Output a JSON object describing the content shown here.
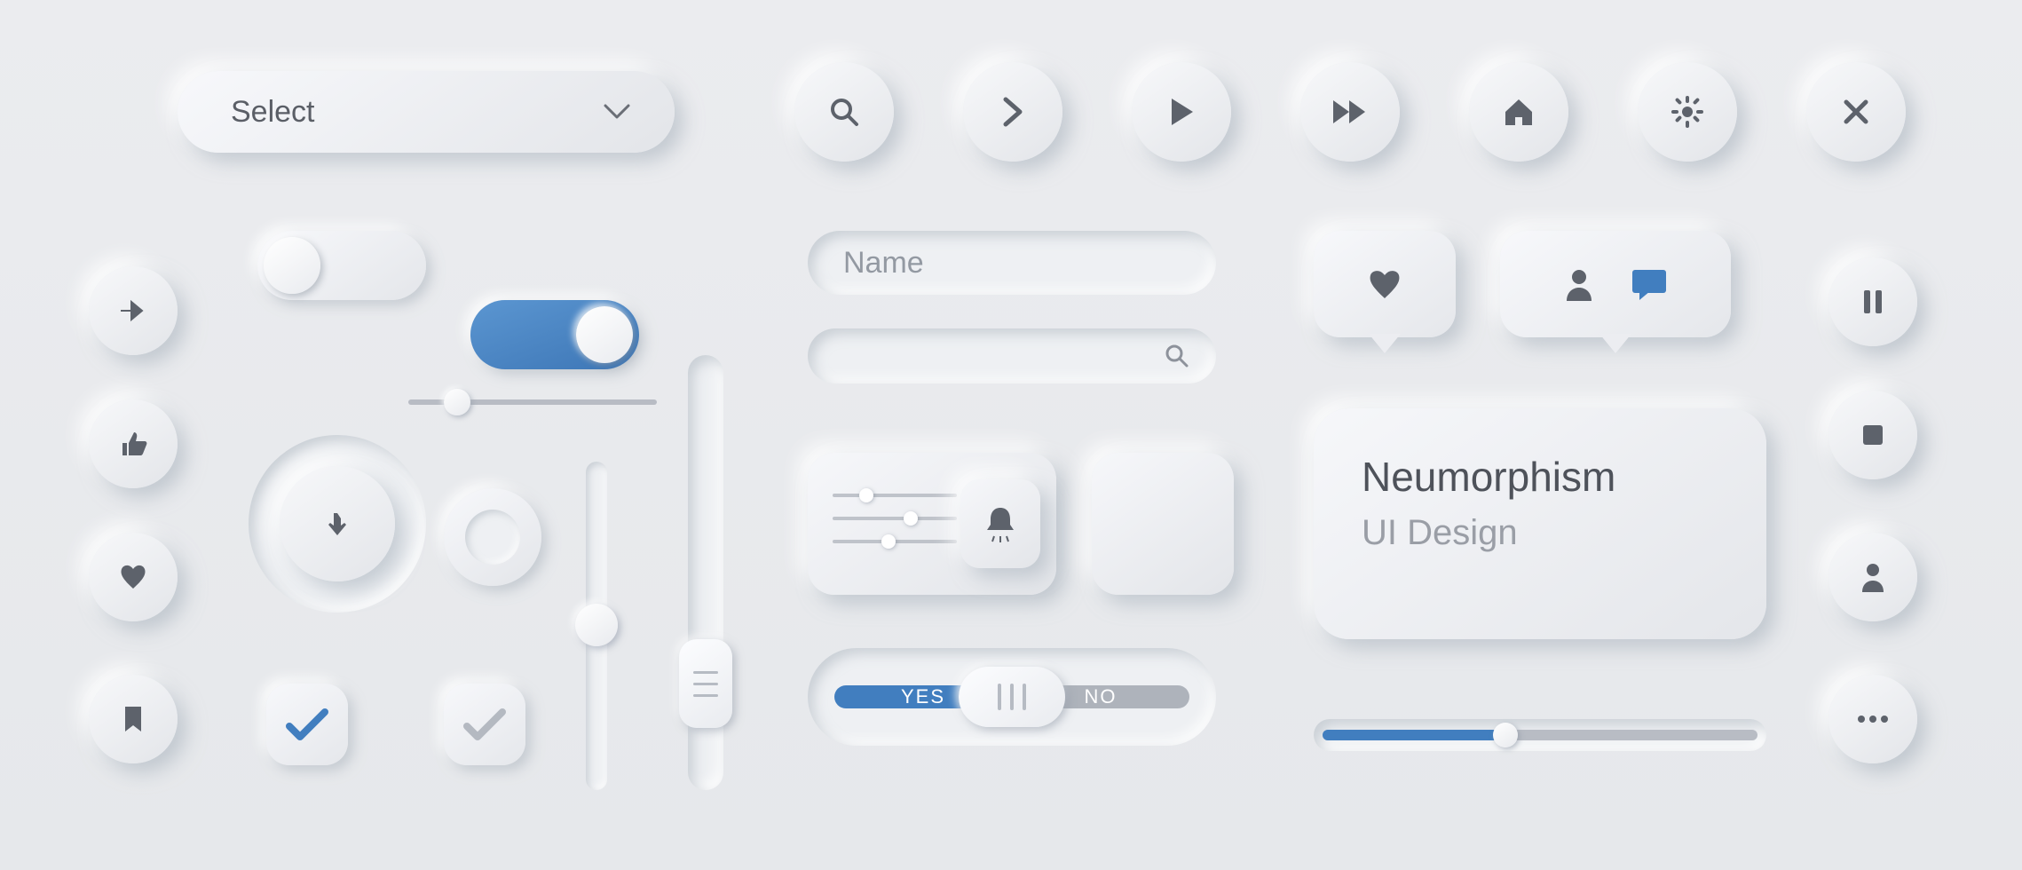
{
  "select": {
    "label": "Select"
  },
  "iconButtons": {
    "search": "search-icon",
    "next": "chevron-right-icon",
    "play": "play-icon",
    "forward": "fast-forward-icon",
    "home": "home-icon",
    "settings": "gear-icon",
    "close": "close-icon"
  },
  "toggles": {
    "off": false,
    "on": true
  },
  "nameInput": {
    "placeholder": "Name"
  },
  "smallActions": {
    "share": "arrow-right-icon",
    "like": "thumbs-up-icon",
    "heart": "heart-icon",
    "bookmark": "bookmark-icon"
  },
  "checks": {
    "blue": true,
    "grey": true
  },
  "hSlider": {
    "min": 0,
    "max": 100,
    "value": 15
  },
  "ring": {
    "value": 0
  },
  "vSliderA": {
    "min": 0,
    "max": 100,
    "value": 30,
    "knobLines": 3
  },
  "vSliderB": {
    "min": 0,
    "max": 100,
    "value": 50
  },
  "bell": {
    "rows": 3,
    "rowValues": [
      25,
      55,
      40
    ]
  },
  "ynSwitch": {
    "yes": "YES",
    "no": "NO",
    "state": "center"
  },
  "tooltipHeart": "heart-icon",
  "tooltipUserChat": {
    "left": "user-icon",
    "right": "chat-icon"
  },
  "card": {
    "title": "Neumorphism",
    "subtitle": "UI Design"
  },
  "progress": {
    "min": 0,
    "max": 100,
    "value": 42
  },
  "rightCol": {
    "pause": "pause-icon",
    "stop": "stop-icon",
    "profile": "user-icon",
    "more": "more-icon"
  },
  "colors": {
    "accent": "#417ebf",
    "icon": "#5d626b",
    "muted": "#9399a2"
  }
}
